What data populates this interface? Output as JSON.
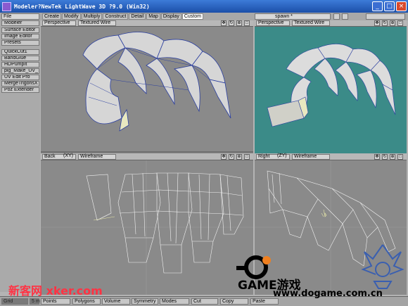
{
  "window": {
    "title": "Modeler?NewTek LightWave 3D ?9.0 (Win32)",
    "buttons": [
      "_",
      "□",
      "×"
    ]
  },
  "menu": {
    "file": "File",
    "tabs": [
      "Create",
      "Modify",
      "Multiply",
      "Construct",
      "Detail",
      "Map",
      "Display",
      "Custom"
    ],
    "active_tab": "Custom",
    "spawn": "spawn *"
  },
  "sidebar": {
    "modeler": "Modeler",
    "items": [
      "Surface Editor",
      "Image Editor",
      "Presets"
    ],
    "custom_items": [
      "QuickCut1",
      "BandGlue",
      "HDPumpIt",
      "plg_Make_UV_",
      "UV Edit Pro",
      "MergeTrigonsX",
      "Poz Extender"
    ]
  },
  "viewports": {
    "top_left": {
      "view": "Perspective",
      "mode": "Textured Wire"
    },
    "top_right": {
      "view": "Perspective",
      "mode": "Textured Wire"
    },
    "bottom_left": {
      "view": "Back",
      "axis": "(XY)",
      "mode": "Wireframe"
    },
    "bottom_right": {
      "view": "Right",
      "axis": "(ZY)",
      "mode": "Wireframe"
    },
    "icons": [
      "move-icon",
      "rotate-icon",
      "zoom-icon",
      "maximize-icon"
    ]
  },
  "bottombar": {
    "items": [
      "Grid",
      "5 m",
      "Points",
      "Polygons",
      "Volume",
      "Symmetry",
      "Modes",
      "Cut",
      "Copy",
      "Paste"
    ]
  },
  "colors": {
    "title_bar": "#2a62c4",
    "viewport_bg": "#8a8a8a",
    "viewport_active_bg": "#3b8b88",
    "wire": "#2b3fa0"
  },
  "watermarks": {
    "left": "新客网 xker.com",
    "game": "GAME游戏",
    "url": "www.dogame.com.cn"
  }
}
